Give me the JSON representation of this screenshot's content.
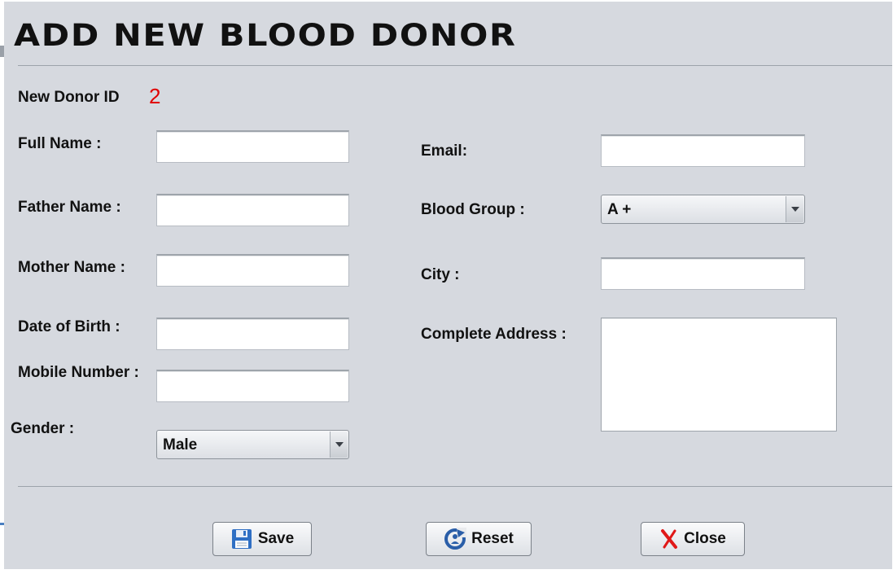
{
  "window": {
    "title": "ADD NEW BLOOD DONOR"
  },
  "donor_id": {
    "label": "New Donor ID",
    "value": "2"
  },
  "form": {
    "full_name": {
      "label": "Full Name :",
      "value": ""
    },
    "father_name": {
      "label": "Father Name :",
      "value": ""
    },
    "mother_name": {
      "label": "Mother Name :",
      "value": ""
    },
    "date_of_birth": {
      "label": "Date of Birth :",
      "value": ""
    },
    "mobile_number": {
      "label": "Mobile Number :",
      "value": ""
    },
    "gender": {
      "label": "Gender :",
      "selected": "Male"
    },
    "email": {
      "label": "Email:",
      "value": ""
    },
    "blood_group": {
      "label": "Blood Group :",
      "selected": "A +"
    },
    "city": {
      "label": "City :",
      "value": ""
    },
    "address": {
      "label": "Complete Address :",
      "value": ""
    }
  },
  "buttons": {
    "save": {
      "label": "Save",
      "icon": "floppy-disk-icon"
    },
    "reset": {
      "label": "Reset",
      "icon": "refresh-icon"
    },
    "close": {
      "label": "Close",
      "icon": "close-x-icon"
    }
  },
  "colors": {
    "background": "#d6d9df",
    "donor_id": "#e00000",
    "save_icon": "#2f6fc4",
    "reset_icon": "#2a5ea8",
    "close_icon": "#e01818"
  }
}
